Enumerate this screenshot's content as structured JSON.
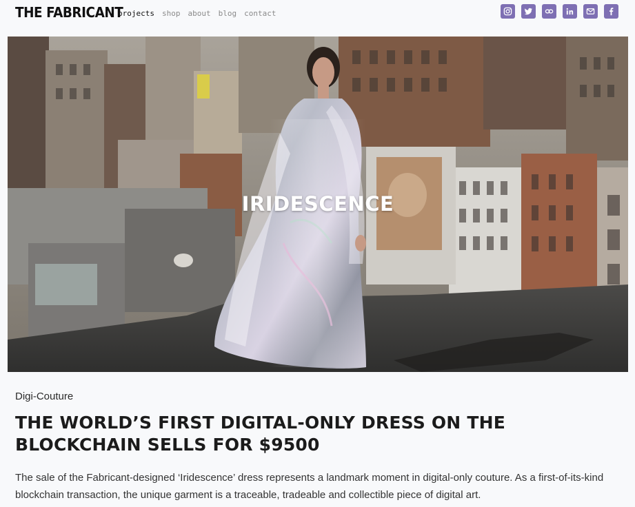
{
  "header": {
    "logo": "THE FABRICANT",
    "nav": [
      {
        "label": "projects",
        "active": true
      },
      {
        "label": "shop",
        "active": false
      },
      {
        "label": "about",
        "active": false
      },
      {
        "label": "blog",
        "active": false
      },
      {
        "label": "contact",
        "active": false
      }
    ],
    "social_icons": [
      "instagram-icon",
      "twitter-icon",
      "link-icon",
      "linkedin-icon",
      "email-icon",
      "facebook-icon"
    ],
    "social_color": "#7e6fb3"
  },
  "hero": {
    "title": "IRIDESCENCE"
  },
  "article": {
    "category": "Digi-Couture",
    "headline": "THE WORLD’S FIRST DIGITAL-ONLY DRESS ON THE BLOCKCHAIN SELLS FOR $9500",
    "lede": "The sale of the Fabricant-designed ‘Iridescence’ dress represents a landmark moment in digital-only couture. As a first-of-its-kind blockchain transaction, the unique garment is a traceable, tradeable and collectible piece of digital art."
  }
}
